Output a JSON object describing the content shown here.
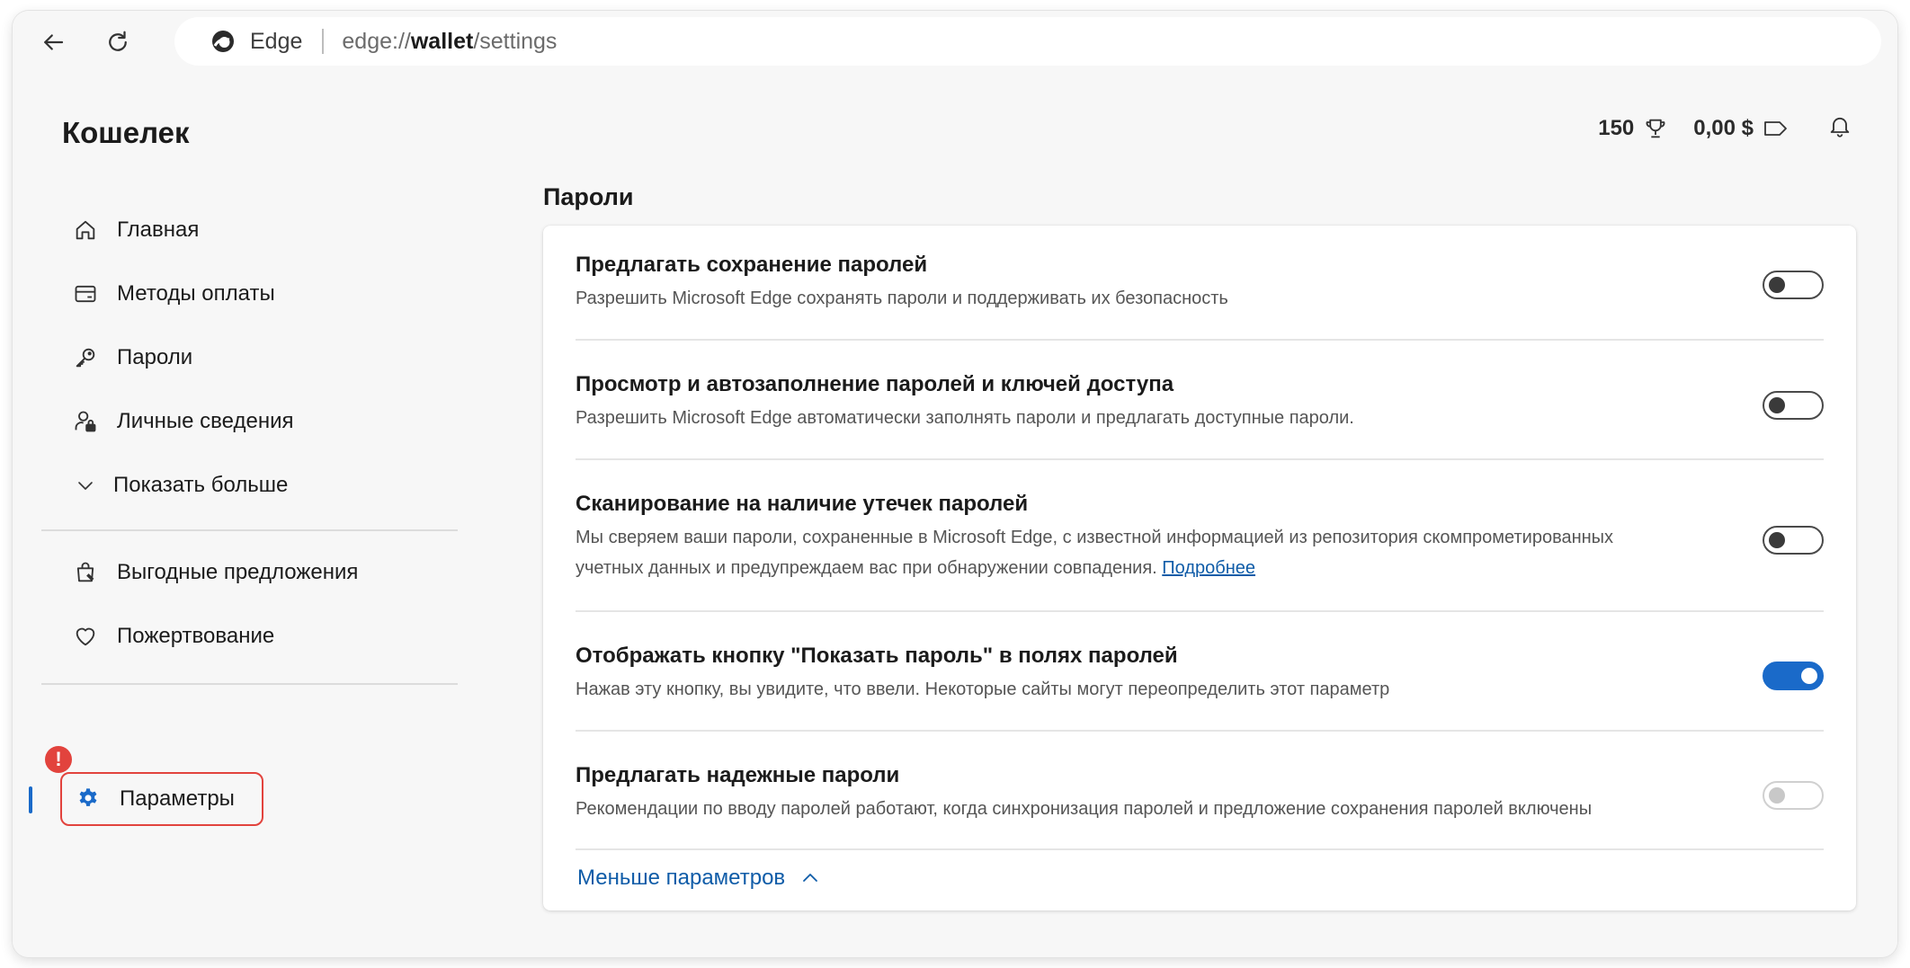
{
  "browser": {
    "back_icon": "arrow-left-icon",
    "reload_icon": "refresh-icon",
    "brand": "Edge",
    "url_prefix": "edge://",
    "url_host": "wallet",
    "url_path": "/settings"
  },
  "header": {
    "title": "Кошелек",
    "rewards_points": "150",
    "cashback": "0,00 $",
    "notifications_icon": "bell-icon"
  },
  "sidebar": {
    "items": [
      {
        "label": "Главная",
        "icon": "home-icon"
      },
      {
        "label": "Методы оплаты",
        "icon": "card-icon"
      },
      {
        "label": "Пароли",
        "icon": "key-icon"
      },
      {
        "label": "Личные сведения",
        "icon": "person-lock-icon"
      },
      {
        "label": "Показать больше",
        "icon": "chevron-down-icon"
      },
      {
        "label": "Выгодные предложения",
        "icon": "shopping-bag-icon"
      },
      {
        "label": "Пожертвование",
        "icon": "heart-icon"
      },
      {
        "label": "Параметры",
        "icon": "gear-icon",
        "active": true
      }
    ],
    "alert_badge": "!"
  },
  "main": {
    "section_title": "Пароли",
    "settings": [
      {
        "title": "Предлагать сохранение паролей",
        "description": "Разрешить Microsoft Edge сохранять пароли и поддерживать их безопасность",
        "state": "off"
      },
      {
        "title": "Просмотр и автозаполнение паролей и ключей доступа",
        "description": "Разрешить Microsoft Edge автоматически заполнять пароли и предлагать доступные пароли.",
        "state": "off"
      },
      {
        "title": "Сканирование на наличие утечек паролей",
        "description": "Мы сверяем ваши пароли, сохраненные в Microsoft Edge, с известной информацией из репозитория скомпрометированных учетных данных и предупреждаем вас при обнаружении совпадения.",
        "link": "Подробнее",
        "state": "off"
      },
      {
        "title": "Отображать кнопку \"Показать пароль\" в полях паролей",
        "description": "Нажав эту кнопку, вы увидите, что ввели. Некоторые сайты могут переопределить этот параметр",
        "state": "on"
      },
      {
        "title": "Предлагать надежные пароли",
        "description": "Рекомендации по вводу паролей работают, когда синхронизация паролей и предложение сохранения паролей включены",
        "state": "disabled"
      }
    ],
    "less_options": "Меньше параметров"
  },
  "colors": {
    "accent": "#1a6ac9",
    "link": "#0f5ca8",
    "alert": "#e2433d"
  }
}
